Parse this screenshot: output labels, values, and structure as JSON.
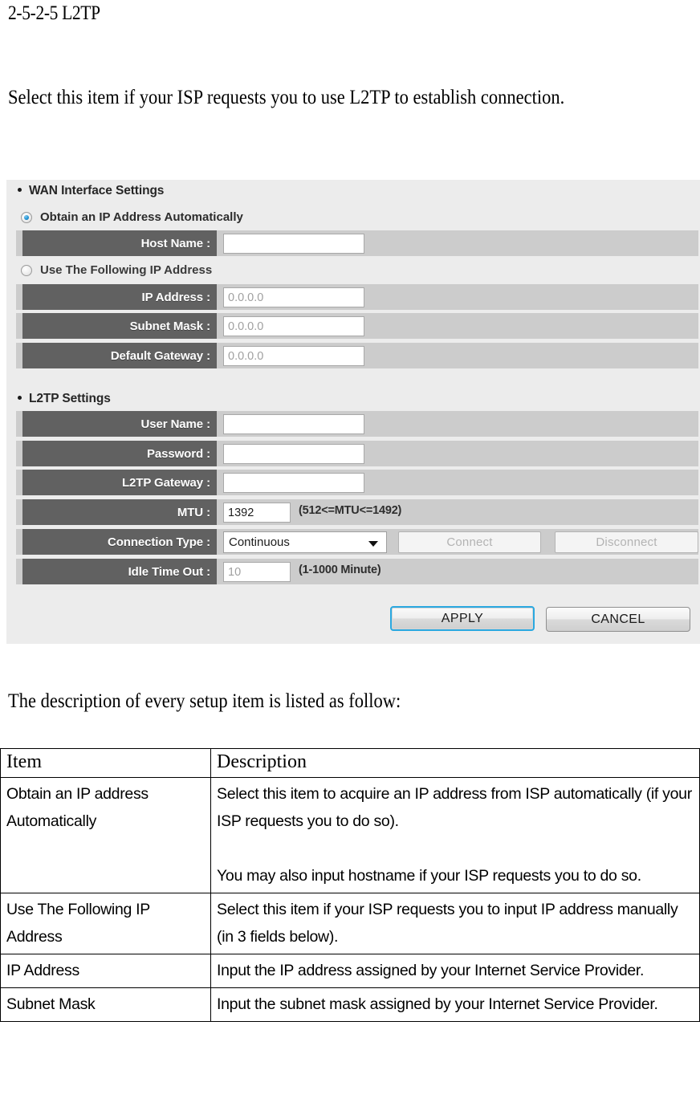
{
  "document": {
    "heading": "2-5-2-5 L2TP",
    "intro_paragraph": "Select this item if your ISP requests you to use L2TP to establish connection.",
    "follow_paragraph": "The description of every setup item is listed as follow:"
  },
  "screenshot": {
    "wan_section": {
      "title": "WAN Interface Settings",
      "radio_auto": {
        "label": "Obtain an IP Address Automatically",
        "selected": true
      },
      "radio_manual": {
        "label": "Use The Following IP Address",
        "selected": false
      },
      "fields": [
        {
          "label": "Host Name :",
          "value": "",
          "placeholder": ""
        },
        {
          "label": "IP Address :",
          "value": "0.0.0.0"
        },
        {
          "label": "Subnet Mask :",
          "value": "0.0.0.0"
        },
        {
          "label": "Default Gateway :",
          "value": "0.0.0.0"
        }
      ]
    },
    "l2tp_section": {
      "title": "L2TP Settings",
      "fields": [
        {
          "label": "User Name :",
          "value": ""
        },
        {
          "label": "Password :",
          "value": ""
        },
        {
          "label": "L2TP Gateway :",
          "value": ""
        },
        {
          "label": "MTU :",
          "value": "1392",
          "hint": "(512<=MTU<=1492)"
        },
        {
          "label": "Connection Type :",
          "value": "Continuous"
        },
        {
          "label": "Idle Time Out :",
          "value": "10",
          "hint": "(1-1000 Minute)"
        }
      ],
      "connect_button": "Connect",
      "disconnect_button": "Disconnect"
    },
    "actions": {
      "apply": "APPLY",
      "cancel": "CANCEL"
    },
    "colors": {
      "panel_background": "#ececec",
      "row_background": "#cccccc",
      "label_cell": "#616161",
      "focus_ring": "#2aa8e0",
      "radio_dot": "#1b8fd1"
    }
  },
  "table": {
    "headers": [
      "Item",
      "Description"
    ],
    "rows": [
      {
        "item": "Obtain an IP address Automatically",
        "description_p1": "Select this item to acquire an IP address from ISP automatically (if your ISP requests you to do so).",
        "description_p2": "You may also input hostname if your ISP requests you to do so."
      },
      {
        "item": "Use The Following IP Address",
        "description_p1": "Select this item if your ISP requests you to input IP address manually (in 3 fields below).",
        "description_p2": ""
      },
      {
        "item": "IP Address",
        "description_p1": "Input the IP address assigned by your Internet Service Provider.",
        "description_p2": ""
      },
      {
        "item": "Subnet Mask",
        "description_p1": "Input the subnet mask assigned by your Internet Service Provider.",
        "description_p2": ""
      }
    ]
  }
}
